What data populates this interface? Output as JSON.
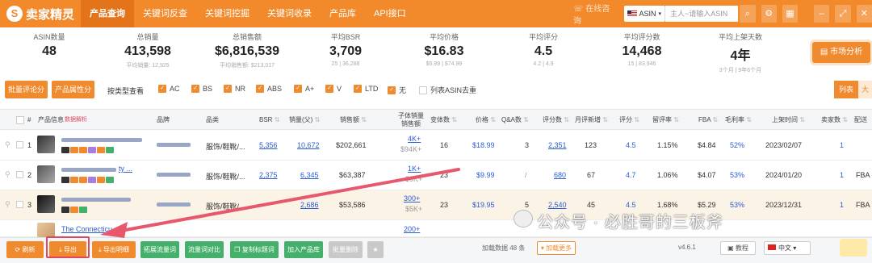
{
  "app": {
    "logo_text": "卖家精灵",
    "logo_mark": "S"
  },
  "nav": [
    "产品查询",
    "关键词反查",
    "关键词挖掘",
    "关键词收录",
    "产品库",
    "API接口"
  ],
  "topbar": {
    "support": "在线咨询",
    "market": "ASIN",
    "search_placeholder": "主人~请输入ASIN"
  },
  "stats": [
    {
      "label": "ASIN数量",
      "value": "48",
      "sub": ""
    },
    {
      "label": "总销量",
      "value": "413,598",
      "sub": "平均销量: 12,925"
    },
    {
      "label": "总销售额",
      "value": "$6,816,539",
      "sub": "平均销售额: $213,017"
    },
    {
      "label": "平均BSR",
      "value": "3,709",
      "sub": "25 | 36,288"
    },
    {
      "label": "平均价格",
      "value": "$16.83",
      "sub": "$5.99 | $74.99"
    },
    {
      "label": "平均评分",
      "value": "4.5",
      "sub": "4.2 | 4.9"
    },
    {
      "label": "平均评分数",
      "value": "14,468",
      "sub": "15 | 83,946"
    },
    {
      "label": "平均上架天数",
      "value": "4年",
      "sub": "3个月 | 9年6个月"
    }
  ],
  "market_button": "市场分析",
  "filters": {
    "review_btn": "批量评论分析",
    "attr_btn": "产品属性分析",
    "type_label": "按类型查看",
    "types": [
      {
        "label": "AC",
        "checked": true
      },
      {
        "label": "BS",
        "checked": true
      },
      {
        "label": "NR",
        "checked": true
      },
      {
        "label": "ABS",
        "checked": true
      },
      {
        "label": "A+",
        "checked": true
      },
      {
        "label": "V",
        "checked": true
      },
      {
        "label": "LTD",
        "checked": true
      },
      {
        "label": "无",
        "checked": true
      },
      {
        "label": "列表ASIN去重",
        "checked": false
      }
    ],
    "view_list": "列表",
    "view_big": "大"
  },
  "table": {
    "headers": {
      "num": "#",
      "info": "产品信息",
      "info_link": "数据解析",
      "brand": "品牌",
      "category": "品类",
      "bsr": "BSR",
      "sales": "销量(父)",
      "revenue": "销售额",
      "child_sales_1": "子体销量",
      "child_sales_2": "销售额",
      "variants": "变体数",
      "price": "价格",
      "qa": "Q&A数",
      "reviews": "评分数",
      "monthly_new": "月评新增",
      "rating": "评分",
      "retention": "留评率",
      "fba": "FBA",
      "margin": "毛利率",
      "listed": "上架时间",
      "sellers": "卖家数",
      "delivery": "配送"
    },
    "rows": [
      {
        "n": "1",
        "category": "服饰/鞋靴/...",
        "bsr": "5,356",
        "sales": "10,672",
        "revenue": "$202,661",
        "child_top": "4K+",
        "child_bottom": "$94K+",
        "variants": "16",
        "price": "$18.99",
        "qa": "3",
        "reviews": "2,351",
        "monthly_new": "123",
        "rating": "4.5",
        "retention": "1.15%",
        "fba": "$4.84",
        "margin": "52%",
        "listed": "2023/02/07",
        "sellers": "1",
        "delivery": "FBA"
      },
      {
        "n": "2",
        "title_tail": "ty ...",
        "category": "服饰/鞋靴/...",
        "bsr": "2,375",
        "sales": "6,345",
        "revenue": "$63,387",
        "child_top": "1K+",
        "child_bottom": "$9K+",
        "variants": "23",
        "price": "$9.99",
        "qa": "/",
        "reviews": "680",
        "monthly_new": "67",
        "rating": "4.7",
        "retention": "1.06%",
        "fba": "$4.07",
        "margin": "53%",
        "listed": "2024/01/20",
        "sellers": "1",
        "delivery": "FBA"
      },
      {
        "n": "3",
        "category": "服饰/鞋靴/...",
        "bsr": "",
        "sales": "2,686",
        "revenue": "$53,586",
        "child_top": "300+",
        "child_bottom": "$5K+",
        "variants": "23",
        "price": "$19.95",
        "qa": "5",
        "reviews": "2,540",
        "monthly_new": "45",
        "rating": "4.5",
        "retention": "1.68%",
        "fba": "$5.29",
        "margin": "53%",
        "listed": "2023/12/31",
        "sellers": "1",
        "delivery": "FBA"
      },
      {
        "n": "",
        "title": "The Connecticu",
        "child_top": "200+"
      }
    ]
  },
  "bottom": {
    "refresh": "刷新",
    "export": "导出",
    "export_detail": "导出明细",
    "expand": "拓展流量词",
    "compare": "流量词对比",
    "copy": "复制标题词",
    "add_lib": "加入产品库",
    "batch_delete": "批量删除",
    "loaded": "加载数据 48 条",
    "load_more": "加载更多",
    "version": "v4.6.1",
    "tutorial": "教程",
    "language": "中文"
  },
  "watermark": "公众号 · 必胜哥的三板斧",
  "colors": {
    "brand": "#f28a2c",
    "link": "#2a5bd7",
    "highlight": "#e0475f",
    "green": "#45b06c"
  }
}
